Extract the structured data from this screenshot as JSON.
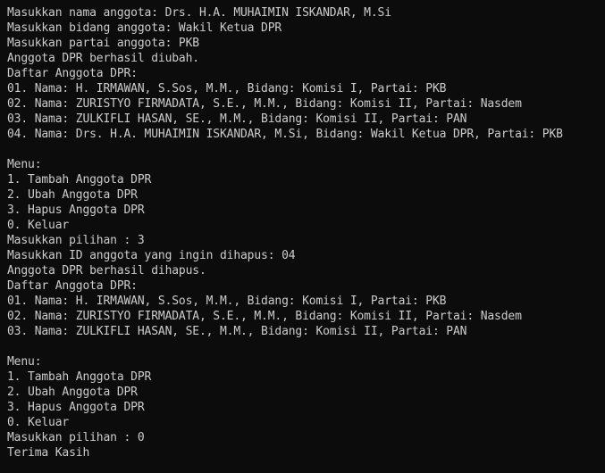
{
  "terminal": {
    "lines": [
      "Masukkan nama anggota: Drs. H.A. MUHAIMIN ISKANDAR, M.Si",
      "Masukkan bidang anggota: Wakil Ketua DPR",
      "Masukkan partai anggota: PKB",
      "Anggota DPR berhasil diubah.",
      "Daftar Anggota DPR:",
      "01. Nama: H. IRMAWAN, S.Sos, M.M., Bidang: Komisi I, Partai: PKB",
      "02. Nama: ZURISTYO FIRMADATA, S.E., M.M., Bidang: Komisi II, Partai: Nasdem",
      "03. Nama: ZULKIFLI HASAN, SE., M.M., Bidang: Komisi II, Partai: PAN",
      "04. Nama: Drs. H.A. MUHAIMIN ISKANDAR, M.Si, Bidang: Wakil Ketua DPR, Partai: PKB",
      "",
      "Menu:",
      "1. Tambah Anggota DPR",
      "2. Ubah Anggota DPR",
      "3. Hapus Anggota DPR",
      "0. Keluar",
      "Masukkan pilihan : 3",
      "Masukkan ID anggota yang ingin dihapus: 04",
      "Anggota DPR berhasil dihapus.",
      "Daftar Anggota DPR:",
      "01. Nama: H. IRMAWAN, S.Sos, M.M., Bidang: Komisi I, Partai: PKB",
      "02. Nama: ZURISTYO FIRMADATA, S.E., M.M., Bidang: Komisi II, Partai: Nasdem",
      "03. Nama: ZULKIFLI HASAN, SE., M.M., Bidang: Komisi II, Partai: PAN",
      "",
      "Menu:",
      "1. Tambah Anggota DPR",
      "2. Ubah Anggota DPR",
      "3. Hapus Anggota DPR",
      "0. Keluar",
      "Masukkan pilihan : 0",
      "Terima Kasih"
    ]
  },
  "colors": {
    "background": "#0c0c0c",
    "text": "#cccccc"
  }
}
